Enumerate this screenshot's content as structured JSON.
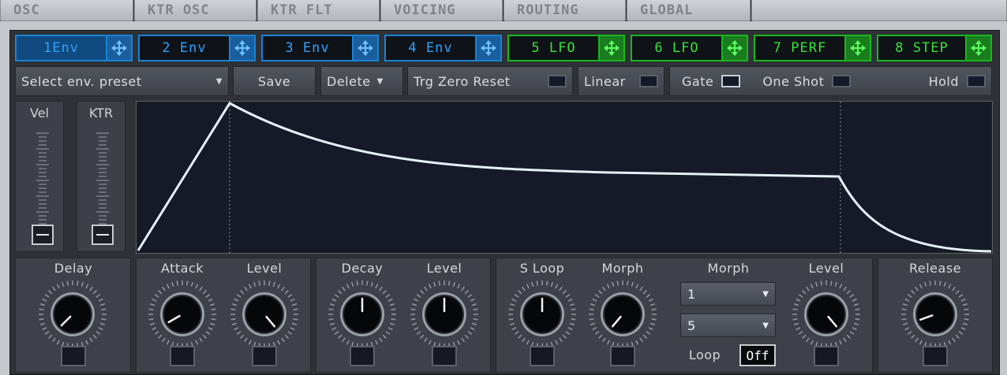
{
  "tabs": [
    "OSC",
    "KTR OSC",
    "KTR FLT",
    "VOICING",
    "ROUTING",
    "GLOBAL"
  ],
  "mod_buttons": [
    {
      "label": "1Env",
      "kind": "env",
      "selected": true
    },
    {
      "label": "2 Env",
      "kind": "env",
      "selected": false
    },
    {
      "label": "3 Env",
      "kind": "env",
      "selected": false
    },
    {
      "label": "4 Env",
      "kind": "env",
      "selected": false
    },
    {
      "label": "5 LFO",
      "kind": "lfo",
      "selected": false
    },
    {
      "label": "6 LFO",
      "kind": "lfo",
      "selected": false
    },
    {
      "label": "7 PERF",
      "kind": "lfo",
      "selected": false
    },
    {
      "label": "8 STEP",
      "kind": "lfo",
      "selected": false
    }
  ],
  "colors": {
    "env_blue": "#2fa2ff",
    "lfo_green": "#37e23a",
    "graph_bg": "#151a26",
    "curve": "#e6f0f6"
  },
  "toolbar": {
    "preset_select": "Select env. preset",
    "save": "Save",
    "delete": "Delete",
    "trg_zero_reset": "Trg Zero Reset",
    "linear": "Linear",
    "gate": "Gate",
    "one_shot": "One Shot",
    "hold": "Hold"
  },
  "sliders": {
    "vel": "Vel",
    "ktr": "KTR"
  },
  "knobs": {
    "delay": "Delay",
    "attack": "Attack",
    "attack_level": "Level",
    "decay": "Decay",
    "decay_level": "Level",
    "s_loop": "S Loop",
    "morph": "Morph",
    "morph_level": "Level",
    "release": "Release"
  },
  "morph_section": {
    "title": "Morph",
    "select1": "1",
    "select2": "5",
    "loop_label": "Loop",
    "loop_value": "Off"
  }
}
